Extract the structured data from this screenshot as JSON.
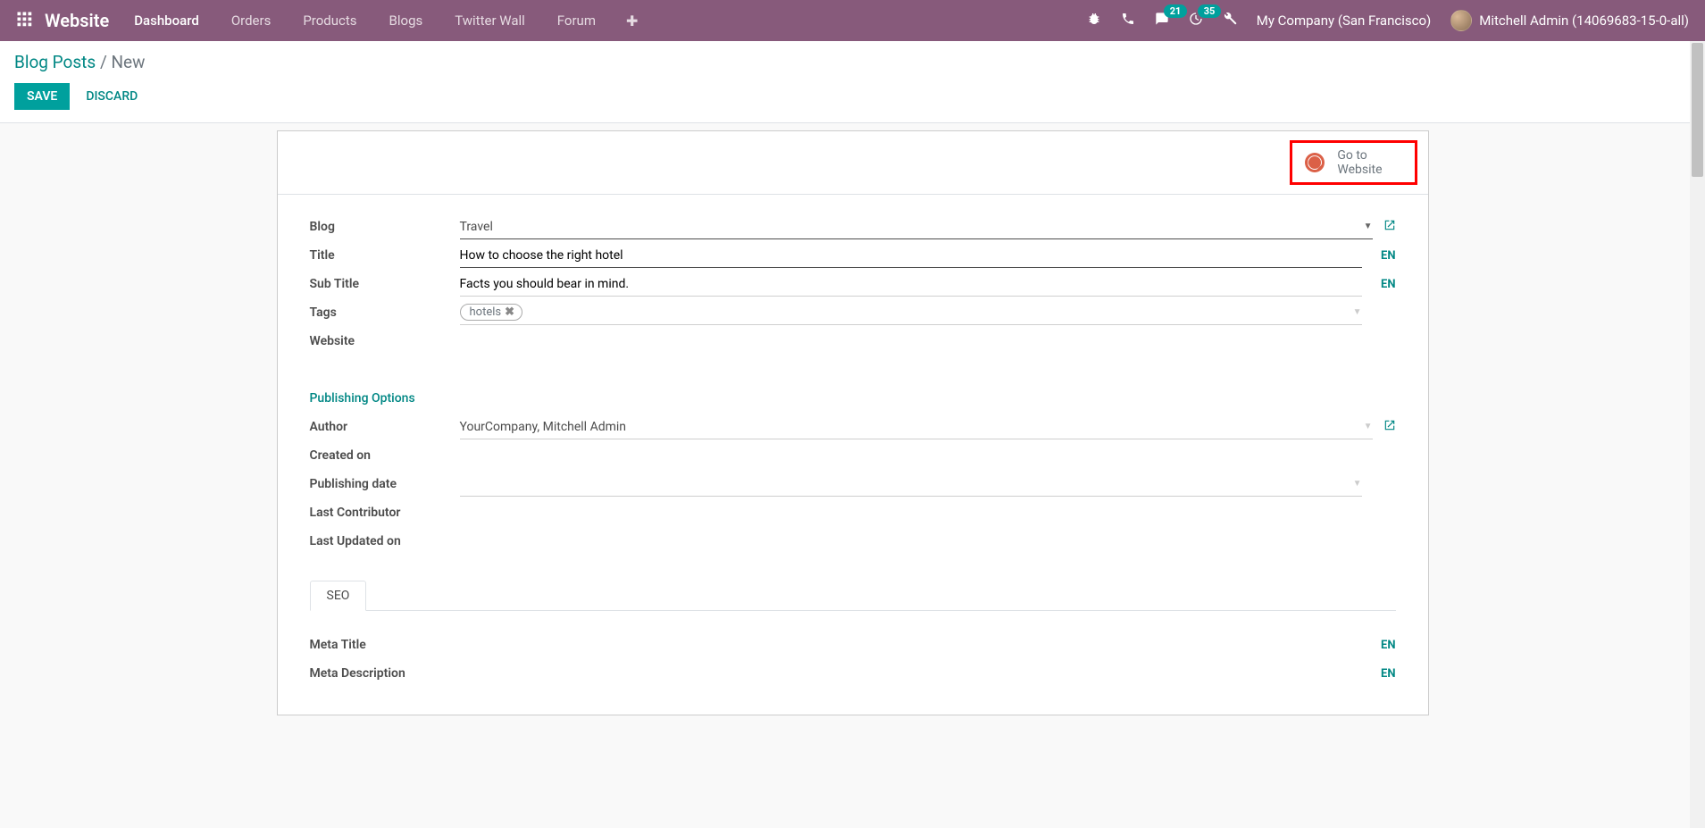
{
  "topbar": {
    "brand": "Website",
    "nav": [
      "Dashboard",
      "Orders",
      "Products",
      "Blogs",
      "Twitter Wall",
      "Forum"
    ],
    "chat_count": "21",
    "activity_count": "35",
    "company": "My Company (San Francisco)",
    "user": "Mitchell Admin (14069683-15-0-all)"
  },
  "breadcrumb": {
    "root": "Blog Posts",
    "sep": "/",
    "current": "New"
  },
  "buttons": {
    "save": "SAVE",
    "discard": "DISCARD"
  },
  "goto": {
    "line1": "Go to",
    "line2": "Website"
  },
  "form": {
    "labels": {
      "blog": "Blog",
      "title": "Title",
      "subtitle": "Sub Title",
      "tags": "Tags",
      "website": "Website",
      "author": "Author",
      "created": "Created on",
      "pubdate": "Publishing date",
      "lastcontrib": "Last Contributor",
      "lastupd": "Last Updated on",
      "metatitle": "Meta Title",
      "metadesc": "Meta Description"
    },
    "section_publishing": "Publishing Options",
    "values": {
      "blog": "Travel",
      "title": "How to choose the right hotel",
      "subtitle": "Facts you should bear in mind.",
      "tag": "hotels",
      "author": "YourCompany, Mitchell Admin"
    },
    "lang": "EN",
    "tabs": {
      "seo": "SEO"
    }
  }
}
